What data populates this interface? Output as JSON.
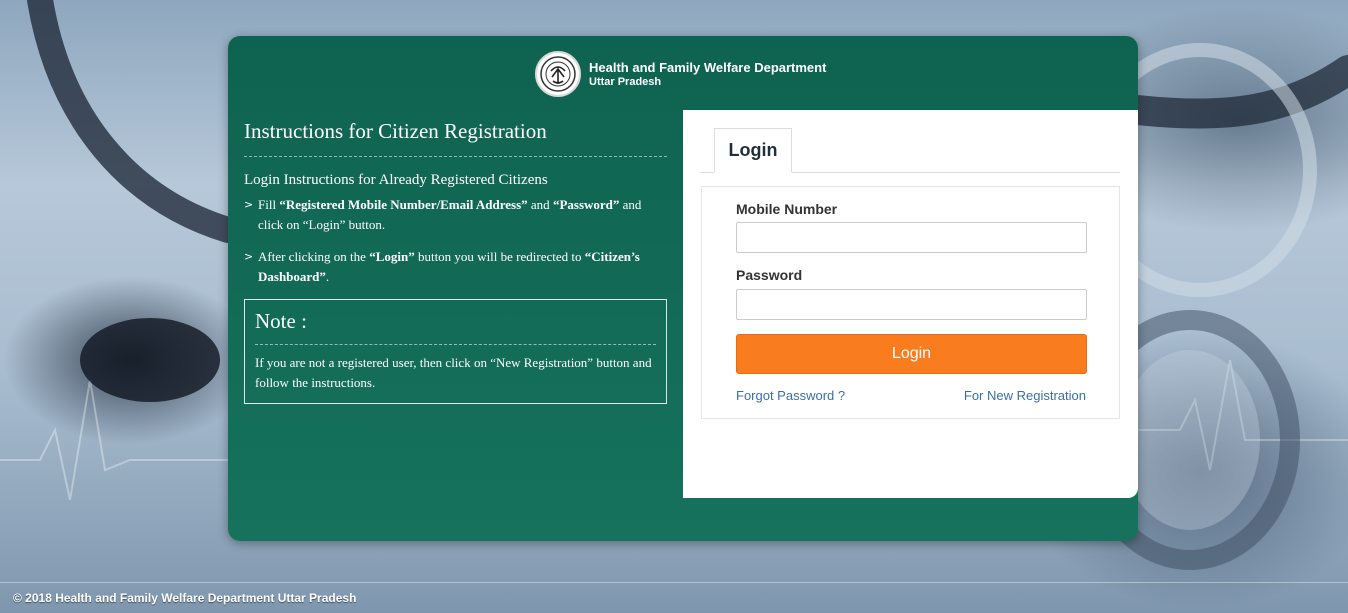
{
  "header": {
    "title": "Health and Family Welfare Department",
    "subtitle": "Uttar Pradesh",
    "emblem_icon": "up-government-emblem-icon"
  },
  "instructions": {
    "title": "Instructions for Citizen Registration",
    "subheading": "Login Instructions for Already Registered Citizens",
    "items": [
      {
        "p1": "Fill ",
        "b1": "“Registered Mobile Number/Email Address”",
        "p2": " and ",
        "b2": "“Password”",
        "p3": " and click on “Login” button."
      },
      {
        "p1": "After clicking on the ",
        "b1": "“Login”",
        "p2": " button you will be redirected to ",
        "b2": "“Citizen’s Dashboard”",
        "p3": "."
      }
    ],
    "bullet_icon": "chevron-right-icon",
    "note": {
      "title": "Note :",
      "text": "If you are not a registered user, then click on “New Registration” button and follow the instructions."
    }
  },
  "login": {
    "tab_label": "Login",
    "mobile_label": "Mobile Number",
    "mobile_value": "",
    "password_label": "Password",
    "password_value": "",
    "button_label": "Login",
    "forgot_link": "Forgot Password ?",
    "register_link": "For New Registration"
  },
  "footer": {
    "text": "© 2018 Health and Family Welfare Department Uttar Pradesh"
  },
  "colors": {
    "panel_green": "#0e6350",
    "login_orange": "#f97c1e",
    "link_blue": "#3a6fa5"
  }
}
